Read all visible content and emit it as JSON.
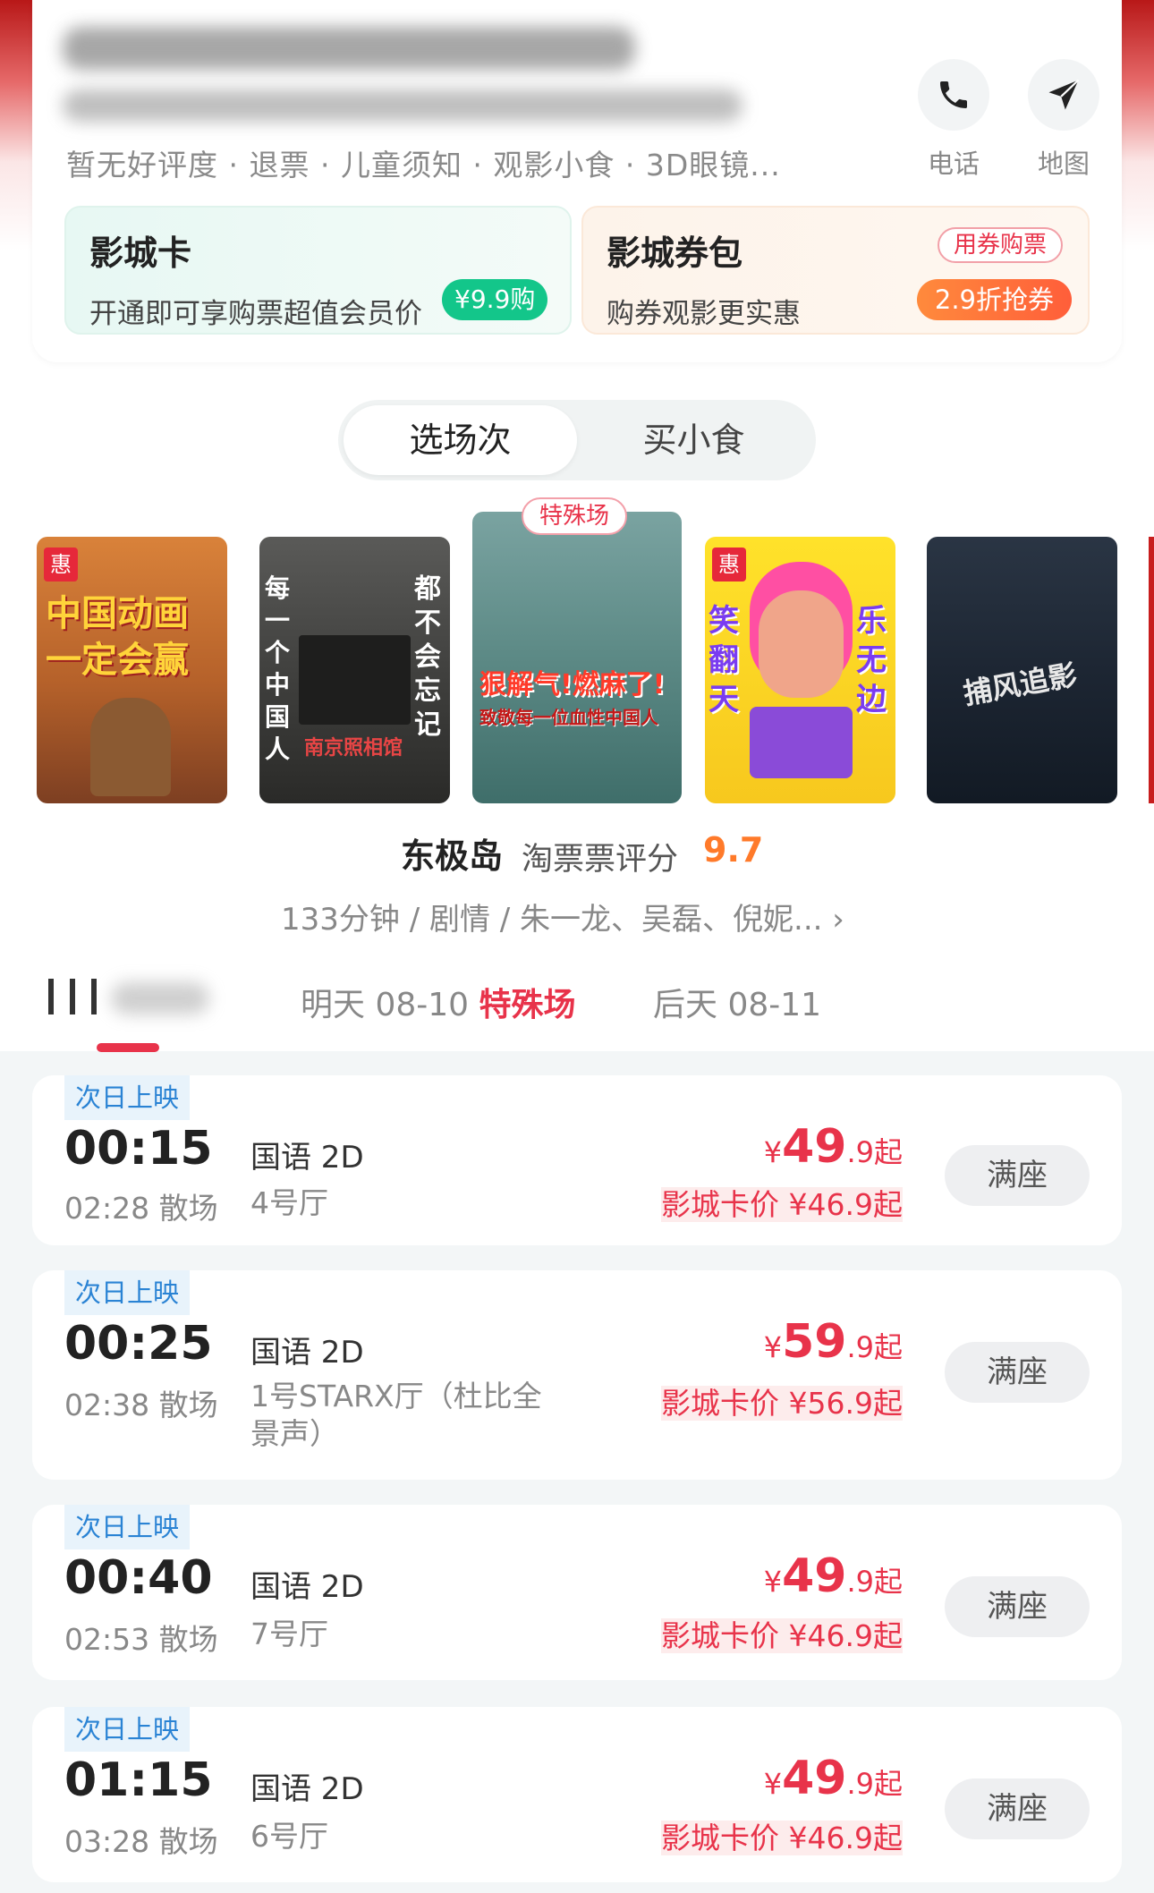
{
  "cinema": {
    "info_line": "暂无好评度 · 退票 · 儿童须知 · 观影小食 · 3D眼镜...",
    "phone_label": "电话",
    "map_label": "地图"
  },
  "promo": {
    "card_title": "影城卡",
    "card_desc": "开通即可享购票超值会员价",
    "card_badge": "¥9.9购",
    "coupon_title": "影城券包",
    "coupon_desc": "购券观影更实惠",
    "coupon_tag": "用券购票",
    "coupon_badge": "2.9折抢券"
  },
  "segments": {
    "showtimes": "选场次",
    "snacks": "买小食"
  },
  "posters": [
    {
      "hui": "惠",
      "text": "中国动画一定会赢"
    },
    {
      "text_left": "每一个中国人",
      "text_right": "都不会忘记",
      "sub": "南京照相馆"
    },
    {
      "tag": "特殊场",
      "text": "狠解气!燃麻了!",
      "sub": "致敬每一位血性中国人"
    },
    {
      "hui": "惠",
      "text_left": "笑翻天",
      "text_right": "乐无边"
    },
    {
      "text": "捕风追影"
    }
  ],
  "movie": {
    "title": "东极岛",
    "rating_label": "淘票票评分",
    "rating": "9.7",
    "meta": "133分钟 / 剧情 / 朱一龙、吴磊、倪妮... ›"
  },
  "dates": {
    "tomorrow": "明天  08-10 ",
    "tomorrow_tag": "特殊场",
    "dayafter": "后天  08-11"
  },
  "shows": [
    {
      "next": "次日上映",
      "time": "00:15",
      "lang": "国语 2D",
      "end": "02:28 散场",
      "hall": "4号厅",
      "price_sym": "¥",
      "price_int": "49",
      "price_dec": ".9起",
      "card_price": "影城卡价 ¥46.9起",
      "status": "满座"
    },
    {
      "next": "次日上映",
      "time": "00:25",
      "lang": "国语 2D",
      "end": "02:38 散场",
      "hall": "1号STARX厅（杜比全景声）",
      "price_sym": "¥",
      "price_int": "59",
      "price_dec": ".9起",
      "card_price": "影城卡价 ¥56.9起",
      "status": "满座"
    },
    {
      "next": "次日上映",
      "time": "00:40",
      "lang": "国语 2D",
      "end": "02:53 散场",
      "hall": "7号厅",
      "price_sym": "¥",
      "price_int": "49",
      "price_dec": ".9起",
      "card_price": "影城卡价 ¥46.9起",
      "status": "满座"
    },
    {
      "next": "次日上映",
      "time": "01:15",
      "lang": "国语 2D",
      "end": "03:28 散场",
      "hall": "6号厅",
      "price_sym": "¥",
      "price_int": "49",
      "price_dec": ".9起",
      "card_price": "影城卡价 ¥46.9起",
      "status": "满座"
    }
  ]
}
